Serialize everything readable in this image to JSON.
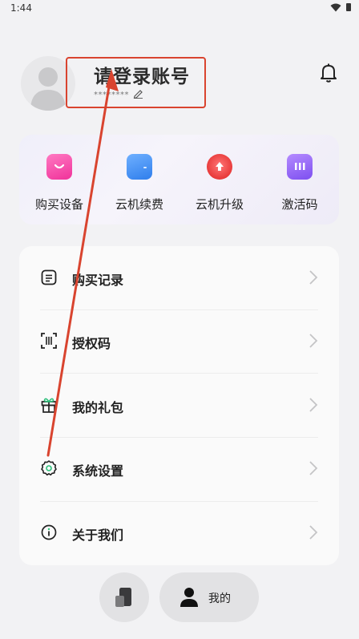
{
  "status_bar": {
    "time": "1:44"
  },
  "profile": {
    "login_prompt": "请登录账号",
    "masked_id": "********"
  },
  "quick_actions": [
    {
      "label": "购买设备",
      "icon": "shopping-bag-icon",
      "color": "#f0329a"
    },
    {
      "label": "云机续费",
      "icon": "wallet-icon",
      "color": "#3d8ef5"
    },
    {
      "label": "云机升级",
      "icon": "upgrade-icon",
      "color": "#f04a4a"
    },
    {
      "label": "激活码",
      "icon": "ticket-icon",
      "color": "#8a5ef0"
    }
  ],
  "menu": [
    {
      "label": "购买记录",
      "icon": "document-icon"
    },
    {
      "label": "授权码",
      "icon": "scan-code-icon"
    },
    {
      "label": "我的礼包",
      "icon": "gift-icon"
    },
    {
      "label": "系统设置",
      "icon": "settings-icon"
    },
    {
      "label": "关于我们",
      "icon": "info-icon"
    }
  ],
  "bottom_nav": {
    "mine_label": "我的"
  },
  "colors": {
    "annotation": "#d9442f",
    "icon_stroke": "#222222"
  }
}
